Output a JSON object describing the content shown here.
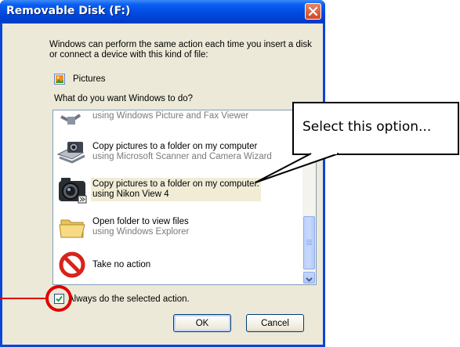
{
  "window": {
    "title": "Removable Disk (F:)",
    "close_icon": "close-icon"
  },
  "intro_text": "Windows can perform the same action each time you insert a disk or connect a device with this kind of file:",
  "content_type": {
    "label": "Pictures",
    "icon": "pictures-icon"
  },
  "question": "What do you want Windows to do?",
  "actions": [
    {
      "line1": "using Windows Picture and Fax Viewer",
      "line2": "",
      "icon": "fax-viewer-icon"
    },
    {
      "line1": "Copy pictures to a folder on my computer",
      "line2": "using Microsoft Scanner and Camera Wizard",
      "icon": "scanner-camera-icon"
    },
    {
      "line1": "Copy pictures to a folder on my computer.",
      "line2": "using Nikon View 4",
      "icon": "nikon-camera-icon",
      "selected": true
    },
    {
      "line1": "Open folder to view files",
      "line2": "using Windows Explorer",
      "icon": "folder-icon"
    },
    {
      "line1": "Take no action",
      "line2": "",
      "icon": "no-action-icon"
    }
  ],
  "always_checkbox": {
    "label": "Always do the selected action.",
    "checked": true
  },
  "buttons": {
    "ok": "OK",
    "cancel": "Cancel"
  },
  "callout": {
    "text": "Select this option..."
  },
  "colors": {
    "title_bar": "#0054e3",
    "close": "#d34622",
    "highlight_circle": "#e00000"
  }
}
